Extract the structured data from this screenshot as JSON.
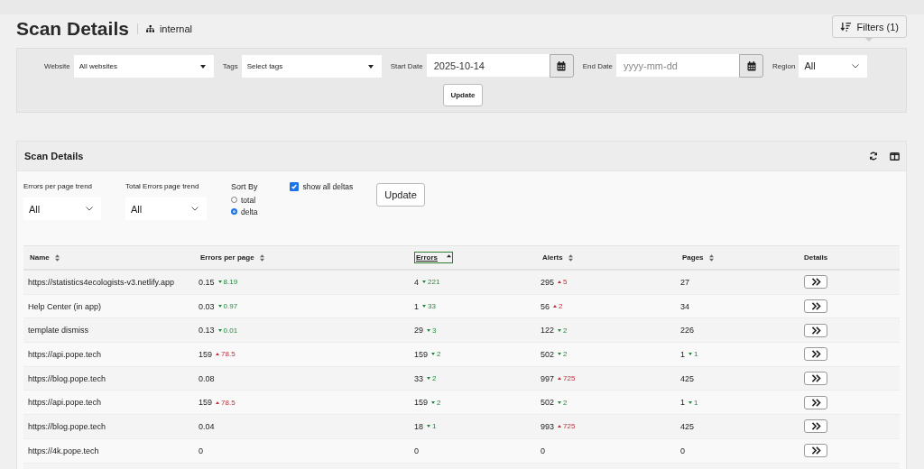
{
  "page": {
    "title": "Scan Details",
    "scope": "internal"
  },
  "filters_button": {
    "label": "Filters (1)"
  },
  "filters": {
    "website": {
      "label": "Website",
      "value": "All websites"
    },
    "tags": {
      "label": "Tags",
      "value": "Select tags"
    },
    "start_date": {
      "label": "Start Date",
      "value": "2025-10-14"
    },
    "end_date": {
      "label": "End Date",
      "placeholder": "yyyy-mm-dd"
    },
    "region": {
      "label": "Region",
      "value": "All"
    },
    "update": "Update"
  },
  "card": {
    "title": "Scan Details",
    "errors_per_page_trend": {
      "label": "Errors per page trend",
      "value": "All"
    },
    "total_errors_trend": {
      "label": "Total Errors page trend",
      "value": "All"
    },
    "sort_by": {
      "label": "Sort By",
      "options": [
        {
          "label": "total",
          "selected": false
        },
        {
          "label": "delta",
          "selected": true
        }
      ]
    },
    "show_all_deltas": {
      "label": "show all deltas",
      "checked": true
    },
    "update": "Update",
    "table": {
      "columns": [
        {
          "label": "Name",
          "sortable": true,
          "selected": false
        },
        {
          "label": "Errors per page",
          "sortable": true,
          "selected": false
        },
        {
          "label": "Errors",
          "sortable": true,
          "selected": true
        },
        {
          "label": "Alerts",
          "sortable": true,
          "selected": false
        },
        {
          "label": "Pages",
          "sortable": true,
          "selected": false
        },
        {
          "label": "Details",
          "sortable": false,
          "selected": false
        }
      ],
      "rows": [
        {
          "cells": [
            {
              "value": "https://statistics4ecologists-v3.netlify.app"
            },
            {
              "value": "0.15",
              "delta": {
                "up": false,
                "text": "8.19"
              }
            },
            {
              "value": "4",
              "delta": {
                "up": false,
                "text": "221"
              }
            },
            {
              "value": "295",
              "delta": {
                "up": true,
                "text": "5"
              }
            },
            {
              "value": "27"
            }
          ]
        },
        {
          "cells": [
            {
              "value": "Help Center (in app)"
            },
            {
              "value": "0.03",
              "delta": {
                "up": false,
                "text": "0.97"
              }
            },
            {
              "value": "1",
              "delta": {
                "up": false,
                "text": "33"
              }
            },
            {
              "value": "56",
              "delta": {
                "up": true,
                "text": "2"
              }
            },
            {
              "value": "34"
            }
          ]
        },
        {
          "cells": [
            {
              "value": "template dismiss"
            },
            {
              "value": "0.13",
              "delta": {
                "up": false,
                "text": "0.01"
              }
            },
            {
              "value": "29",
              "delta": {
                "up": false,
                "text": "3"
              }
            },
            {
              "value": "122",
              "delta": {
                "up": false,
                "text": "2"
              }
            },
            {
              "value": "226"
            }
          ]
        },
        {
          "cells": [
            {
              "value": "https://api.pope.tech"
            },
            {
              "value": "159",
              "delta": {
                "up": true,
                "text": "78.5"
              }
            },
            {
              "value": "159",
              "delta": {
                "up": false,
                "text": "2"
              }
            },
            {
              "value": "502",
              "delta": {
                "up": false,
                "text": "2"
              }
            },
            {
              "value": "1",
              "delta": {
                "up": false,
                "text": "1"
              }
            }
          ]
        },
        {
          "cells": [
            {
              "value": "https://blog.pope.tech"
            },
            {
              "value": "0.08"
            },
            {
              "value": "33",
              "delta": {
                "up": false,
                "text": "2"
              }
            },
            {
              "value": "997",
              "delta": {
                "up": true,
                "text": "725"
              }
            },
            {
              "value": "425"
            }
          ]
        },
        {
          "cells": [
            {
              "value": "https://api.pope.tech"
            },
            {
              "value": "159",
              "delta": {
                "up": true,
                "text": "78.5"
              }
            },
            {
              "value": "159",
              "delta": {
                "up": false,
                "text": "2"
              }
            },
            {
              "value": "502",
              "delta": {
                "up": false,
                "text": "2"
              }
            },
            {
              "value": "1",
              "delta": {
                "up": false,
                "text": "1"
              }
            }
          ]
        },
        {
          "cells": [
            {
              "value": "https://blog.pope.tech"
            },
            {
              "value": "0.04"
            },
            {
              "value": "18",
              "delta": {
                "up": false,
                "text": "1"
              }
            },
            {
              "value": "993",
              "delta": {
                "up": true,
                "text": "725"
              }
            },
            {
              "value": "425"
            }
          ]
        },
        {
          "cells": [
            {
              "value": "https://4k.pope.tech"
            },
            {
              "value": "0"
            },
            {
              "value": "0"
            },
            {
              "value": "0"
            },
            {
              "value": "0"
            }
          ]
        }
      ]
    }
  }
}
